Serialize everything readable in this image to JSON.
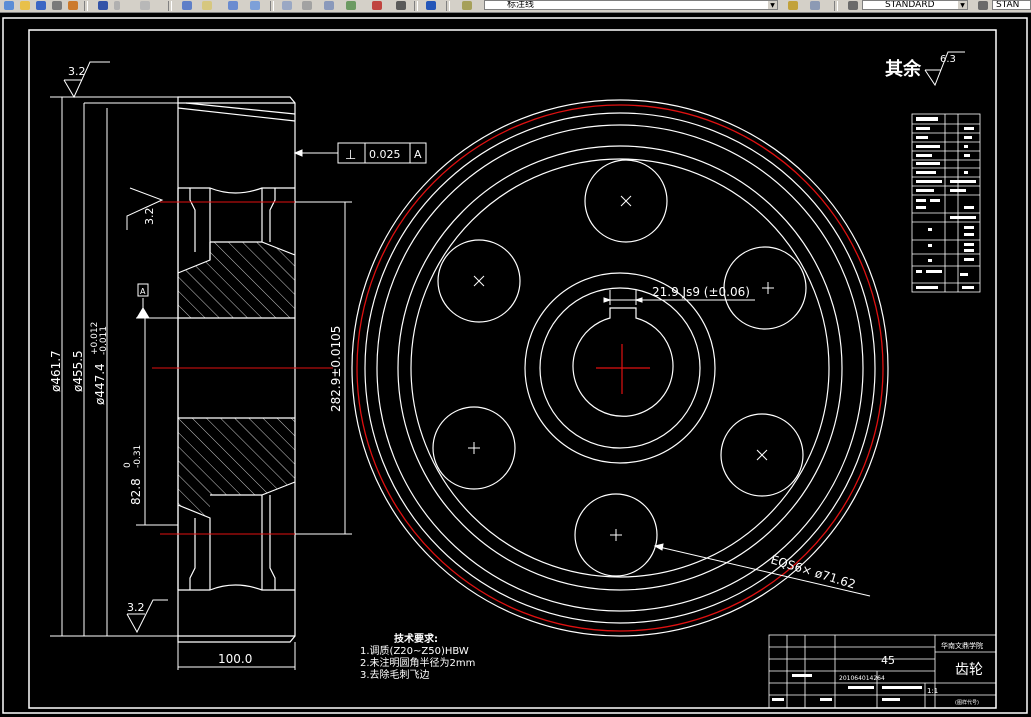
{
  "toolbar": {
    "layer_value": "标注线",
    "style_value": "STANDARD",
    "style2_value": "STAN"
  },
  "drawing": {
    "surface_roughness_default": "其余",
    "surface_roughness_default_value": "6.3",
    "roughness_top": "3.2",
    "roughness_mid": "3.2",
    "roughness_bottom": "3.2",
    "dim_od": "ø461.7",
    "dim_d2": "ø455.5",
    "dim_d3": "ø447.4",
    "dim_d3_tol_upper": "+0.012",
    "dim_d3_tol_lower": "-0.011",
    "dim_height": "282.9±0.0105",
    "dim_82": "82.8",
    "dim_82_tol_upper": "0",
    "dim_82_tol_lower": "-0.31",
    "dim_width": "100.0",
    "tolerance_symbol": "⊥",
    "tolerance_value": "0.025",
    "tolerance_datum": "A",
    "datum_label": "A",
    "keyway_dim": "21.9 Js9 (±0.06)",
    "holes_dim": "EQS6× ø71.62",
    "tech_title": "技术要求:",
    "tech_lines": [
      "1.调质(Z20~Z50)HBW",
      "2.未注明圆角半径为2mm",
      "3.去除毛刺飞边"
    ],
    "title_school": "华南文鼎学院",
    "title_part": "齿轮",
    "title_scale": "1:1",
    "title_number": "201064014264",
    "title_code": "45",
    "title_note": "(图样代号)"
  },
  "param_table": {
    "rows": [
      "模数",
      "齿数",
      "压力角",
      "齿顶高系数",
      "顶隙系数",
      "精度等级",
      "配对齿轮",
      "公差组",
      "检验项目"
    ],
    "values": [
      "3.25",
      "136",
      "20°",
      "1",
      "0.25",
      "8",
      "0",
      "I II III",
      ""
    ]
  }
}
